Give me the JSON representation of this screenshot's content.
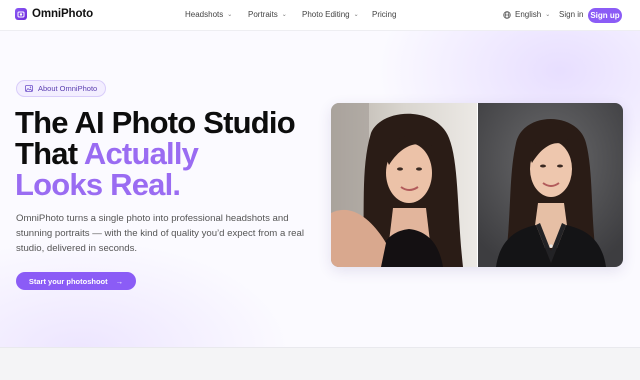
{
  "nav": {
    "brand": "OmniPhoto",
    "brand_icon": "camera-logo-icon",
    "items": [
      {
        "label": "Headshots",
        "has_dropdown": true
      },
      {
        "label": "Portraits",
        "has_dropdown": true
      },
      {
        "label": "Photo Editing",
        "has_dropdown": true
      },
      {
        "label": "Pricing",
        "has_dropdown": false
      }
    ],
    "language": "English",
    "language_icon": "globe-icon",
    "signin": "Sign in",
    "signup": "Sign up"
  },
  "hero": {
    "pill": "About OmniPhoto",
    "pill_icon": "image-icon",
    "headline_line1": "The AI Photo Studio",
    "headline_line2_plain": "That ",
    "headline_line2_accent": "Actually",
    "headline_line3_accent": "Looks Real.",
    "description": "OmniPhoto turns a single photo into professional headshots and stunning portraits — with the kind of quality you’d expect from a real studio, delivered in seconds.",
    "cta": "Start your photoshoot",
    "cta_icon": "arrow-right-icon"
  },
  "images": {
    "before": "selfie-photo",
    "after": "professional-headshot-photo"
  },
  "colors": {
    "accent": "#8b5cf6",
    "accent_text": "#9a6cf2"
  }
}
